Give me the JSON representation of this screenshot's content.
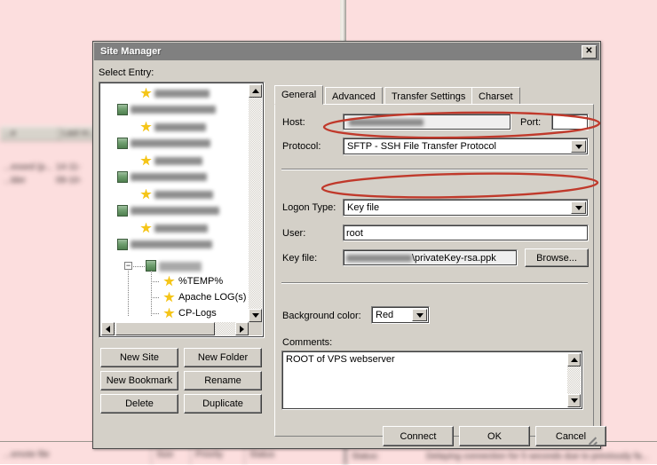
{
  "background_app": {
    "file_pane_headers": [
      "...e",
      "Last m..."
    ],
    "file_rows": [
      {
        "name": "...essed (p...",
        "date": "14-11-"
      },
      {
        "name": "...lder",
        "date": "09-10-"
      }
    ],
    "queue_headers": [
      "...emote file",
      "Size",
      "Priority",
      "Status"
    ],
    "status_label": "Status:",
    "status_message": "Delaying connection for 5 seconds due to previously fa..."
  },
  "dialog": {
    "title": "Site Manager",
    "close_label": "✕",
    "select_entry_label": "Select Entry:",
    "tree": {
      "selected_node_label": "",
      "expander": "−",
      "children": [
        {
          "label": "%TEMP%",
          "icon": "star-icon"
        },
        {
          "label": "Apache LOG(s)",
          "icon": "star-icon"
        },
        {
          "label": "CP-Logs",
          "icon": "star-icon"
        }
      ]
    },
    "entry_buttons": [
      {
        "label": "New Site"
      },
      {
        "label": "New Folder"
      },
      {
        "label": "New Bookmark"
      },
      {
        "label": "Rename"
      },
      {
        "label": "Delete"
      },
      {
        "label": "Duplicate"
      }
    ],
    "tabs": [
      {
        "label": "General",
        "active": true
      },
      {
        "label": "Advanced",
        "active": false
      },
      {
        "label": "Transfer Settings",
        "active": false
      },
      {
        "label": "Charset",
        "active": false
      }
    ],
    "general": {
      "host_label": "Host:",
      "host_value": "",
      "port_label": "Port:",
      "port_value": "",
      "protocol_label": "Protocol:",
      "protocol_value": "SFTP - SSH File Transfer Protocol",
      "logon_type_label": "Logon Type:",
      "logon_type_value": "Key file",
      "user_label": "User:",
      "user_value": "root",
      "keyfile_label": "Key file:",
      "keyfile_value": "\\privateKey-rsa.ppk",
      "browse_label": "Browse...",
      "background_color_label": "Background color:",
      "background_color_value": "Red",
      "comments_label": "Comments:",
      "comments_value": "ROOT of VPS webserver"
    },
    "action_buttons": [
      {
        "label": "Connect"
      },
      {
        "label": "OK"
      },
      {
        "label": "Cancel"
      }
    ]
  },
  "annotations": {
    "color": "#c0392b",
    "highlights": [
      "protocol-field",
      "logon-type-field"
    ]
  },
  "theme": {
    "dialog_face": "#d4d0c8",
    "titlebar": "#808080",
    "background_pink": "#fcdede",
    "field_white": "#ffffff",
    "readonly_field": "#efefef"
  }
}
